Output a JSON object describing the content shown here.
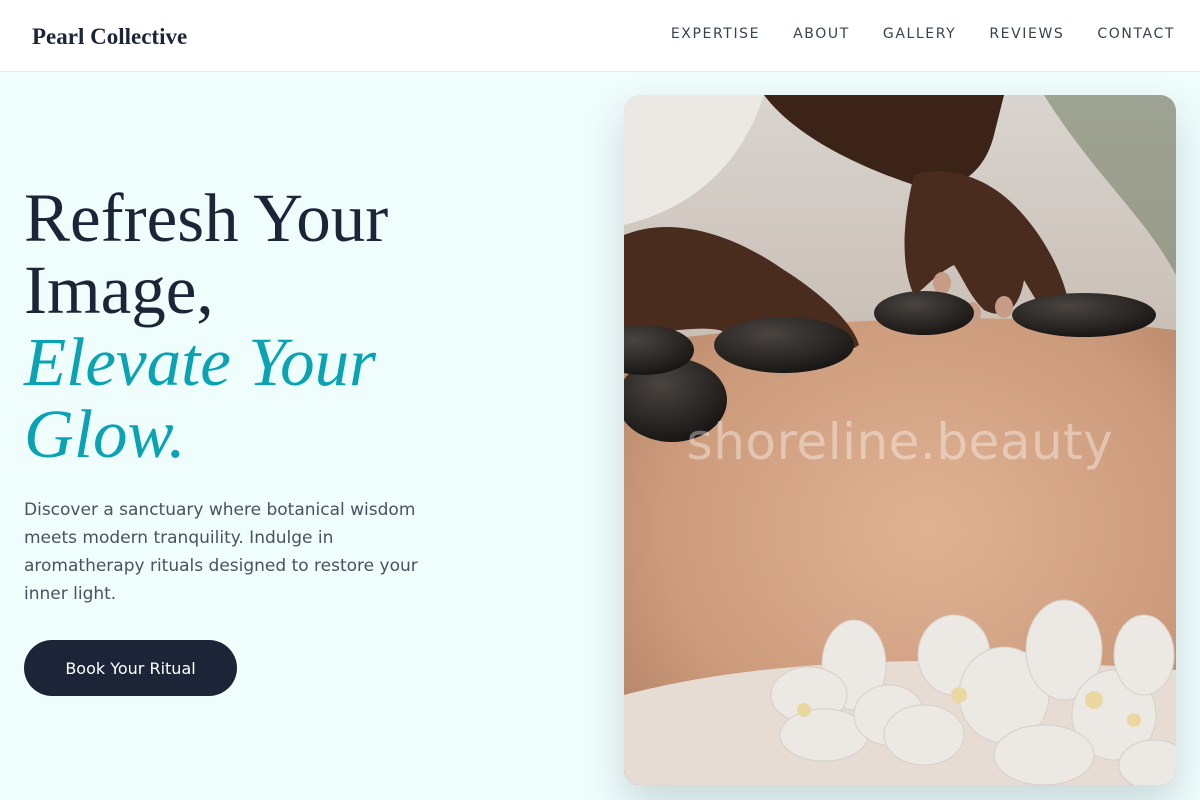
{
  "header": {
    "brand": "Pearl Collective",
    "nav": [
      "EXPERTISE",
      "ABOUT",
      "GALLERY",
      "REVIEWS",
      "CONTACT"
    ]
  },
  "hero": {
    "title_line1": "Refresh Your",
    "title_line2": "Image,",
    "title_accent1": "Elevate Your",
    "title_accent2": "Glow.",
    "description": "Discover a sanctuary where botanical wisdom meets modern tranquility. Indulge in aromatherapy rituals designed to restore your inner light.",
    "cta_label": "Book Your Ritual",
    "image_watermark": "shoreline.beauty",
    "image_subject": "hot stone massage with orchids"
  },
  "colors": {
    "background": "#effdfd",
    "primary": "#1c2538",
    "accent": "#0aa3b3"
  }
}
